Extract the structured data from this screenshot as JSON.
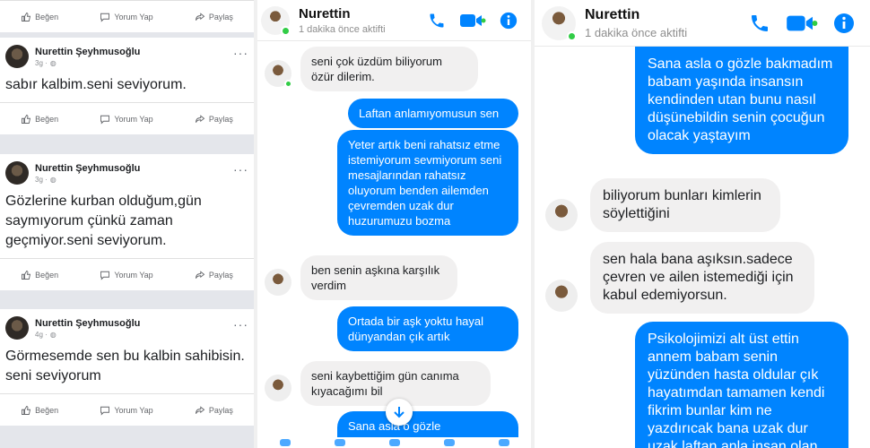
{
  "colors": {
    "messenger_blue": "#0084ff",
    "incoming_bubble": "#f1f0f0",
    "online": "#31cc46"
  },
  "feed": {
    "actions": {
      "like": "Beğen",
      "comment": "Yorum Yap",
      "share": "Paylaş"
    },
    "posts": [
      {
        "author": "Nurettin Şeyhmusoğlu",
        "time": "3g ·",
        "text": "sabır kalbim.seni seviyorum."
      },
      {
        "author": "Nurettin Şeyhmusoğlu",
        "time": "3g ·",
        "text": "Gözlerine kurban olduğum,gün saymıyorum çünkü zaman geçmiyor.seni seviyorum."
      },
      {
        "author": "Nurettin Şeyhmusoğlu",
        "time": "4g ·",
        "text": "Görmesemde sen bu kalbin sahibisin. seni seviyorum"
      }
    ]
  },
  "chat_a": {
    "contact": "Nurettin",
    "status": "1 dakika önce aktifti",
    "messages": [
      {
        "dir": "in",
        "text": "seni çok üzdüm biliyorum özür dilerim."
      },
      {
        "dir": "out",
        "text": "Laftan anlamıyomusun sen"
      },
      {
        "dir": "out",
        "text": "Yeter artık beni rahatsız etme istemiyorum sevmiyorum seni mesajlarından rahatsız oluyorum benden ailemden çevremden uzak dur huzurumuzu bozma"
      },
      {
        "dir": "in",
        "text": "ben senin aşkına karşılık verdim"
      },
      {
        "dir": "out",
        "text": "Ortada bir aşk yoktu hayal dünyandan çık artık"
      },
      {
        "dir": "in",
        "text": "seni kaybettiğim gün canıma kıyacağımı bil"
      },
      {
        "dir": "out",
        "text": "Sana asla o gözle"
      }
    ]
  },
  "chat_b": {
    "contact": "Nurettin",
    "status": "1 dakika önce aktifti",
    "messages": [
      {
        "dir": "out",
        "text": "Sana asla o gözle bakmadım babam yaşında insansın kendinden utan bunu nasıl düşünebildin senin çocuğun olacak yaştayım"
      },
      {
        "dir": "in",
        "text": "biliyorum bunları kimlerin söylettiğini"
      },
      {
        "dir": "in",
        "text": "sen hala bana aşıksın.sadece çevren ve ailen istemediği için kabul edemiyorsun."
      },
      {
        "dir": "out",
        "text": "Psikolojimizi alt üst ettin annem babam senin yüzünden hasta oldular çık hayatımdan tamamen kendi fikrim bunlar kim ne yazdırıcak bana uzak dur uzak laftan anla insan olan"
      }
    ]
  },
  "icons": {
    "call": "phone-icon",
    "video": "video-camera-icon",
    "info": "info-icon",
    "scroll": "arrow-down-icon"
  }
}
